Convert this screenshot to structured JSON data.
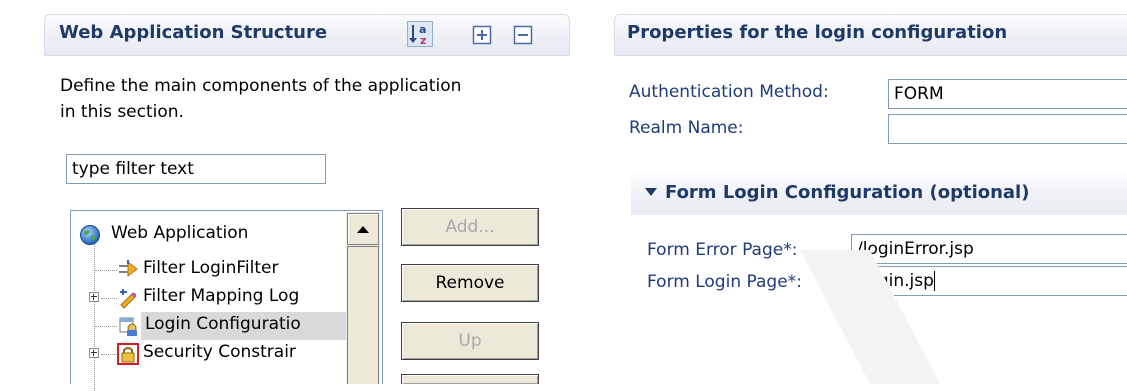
{
  "left_section": {
    "title": "Web Application Structure",
    "description_line1": "Define the main components of the application",
    "description_line2": "in this section.",
    "filter_input": {
      "value": "type filter text"
    },
    "tree": [
      {
        "label": "Web Application",
        "icon": "globe-icon"
      },
      {
        "label": "Filter LoginFilter",
        "icon": "filter-icon"
      },
      {
        "label": "Filter Mapping Log",
        "icon": "filter-mapping-icon"
      },
      {
        "label": "Login Configuratio",
        "icon": "login-config-icon",
        "selected": true
      },
      {
        "label": "Security Constrair",
        "icon": "lock-icon"
      }
    ],
    "buttons": {
      "add": "Add...",
      "remove": "Remove",
      "up": "Up"
    },
    "toolbar_icons": [
      "sort-alphabetical-icon",
      "expand-all-icon",
      "collapse-all-icon"
    ]
  },
  "right_section": {
    "title": "Properties for the login configuration",
    "auth_method_label": "Authentication Method:",
    "auth_method_value": "FORM",
    "realm_name_label": "Realm Name:",
    "realm_name_value": "",
    "form_login": {
      "title": "Form Login Configuration (optional)",
      "error_page_label": "Form Error Page*:",
      "error_page_value": "/loginError.jsp",
      "login_page_label": "Form Login Page*:",
      "login_page_value": "/login.jsp"
    }
  },
  "colors": {
    "title_text": "#1f3a68",
    "label_text": "#1e3c7a",
    "selection": "#d9d9d9",
    "border": "#7f9db9"
  }
}
